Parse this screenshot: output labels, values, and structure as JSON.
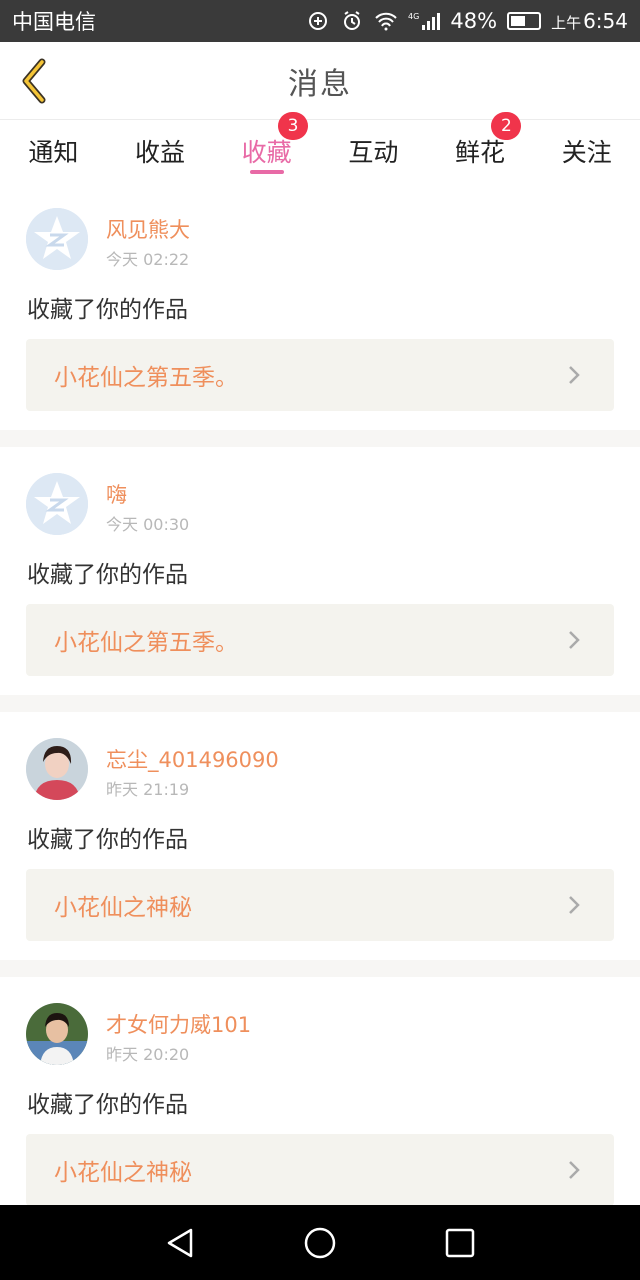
{
  "status_bar": {
    "carrier": "中国电信",
    "network": "4G",
    "battery": "48%",
    "ampm": "上午",
    "time": "6:54"
  },
  "header": {
    "title": "消息",
    "back_icon": "chevron-left-icon"
  },
  "tabs": [
    {
      "label": "通知"
    },
    {
      "label": "收益"
    },
    {
      "label": "收藏",
      "badge": "3"
    },
    {
      "label": "互动"
    },
    {
      "label": "鲜花",
      "badge": "2"
    },
    {
      "label": "关注"
    }
  ],
  "colors": {
    "accent": "#e86aa6",
    "name": "#ef8f5c",
    "badge": "#f0344b"
  },
  "items": [
    {
      "user": "风见熊大",
      "time": "今天 02:22",
      "action": "收藏了你的作品",
      "work": "小花仙之第五季。",
      "avatar": "default-qq"
    },
    {
      "user": "嗨",
      "time": "今天 00:30",
      "action": "收藏了你的作品",
      "work": "小花仙之第五季。",
      "avatar": "default-qq"
    },
    {
      "user": "忘尘_401496090",
      "time": "昨天 21:19",
      "action": "收藏了你的作品",
      "work": "小花仙之神秘",
      "avatar": "photo"
    },
    {
      "user": "才女何力威101",
      "time": "昨天 20:20",
      "action": "收藏了你的作品",
      "work": "小花仙之神秘",
      "avatar": "photo"
    }
  ]
}
